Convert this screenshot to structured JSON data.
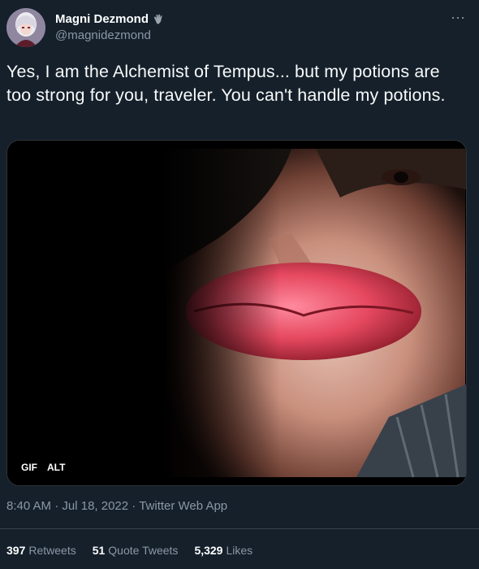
{
  "user": {
    "display_name": "Magni Dezmond",
    "handle": "@magnidezmond"
  },
  "tweet": {
    "text": "Yes, I am the Alchemist of Tempus... but my potions are too strong for you, traveler. You can't handle my potions."
  },
  "media": {
    "badges": [
      "GIF",
      "ALT"
    ]
  },
  "meta": {
    "time": "8:40 AM",
    "date": "Jul 18, 2022",
    "source": "Twitter Web App"
  },
  "stats": {
    "retweets_count": "397",
    "retweets_label": "Retweets",
    "quotes_count": "51",
    "quotes_label": "Quote Tweets",
    "likes_count": "5,329",
    "likes_label": "Likes"
  },
  "icons": {
    "more": "more-options-icon",
    "badge_icon": "hand-wave-icon"
  },
  "colors": {
    "background": "#15202b",
    "secondary_text": "#8b98a5"
  }
}
